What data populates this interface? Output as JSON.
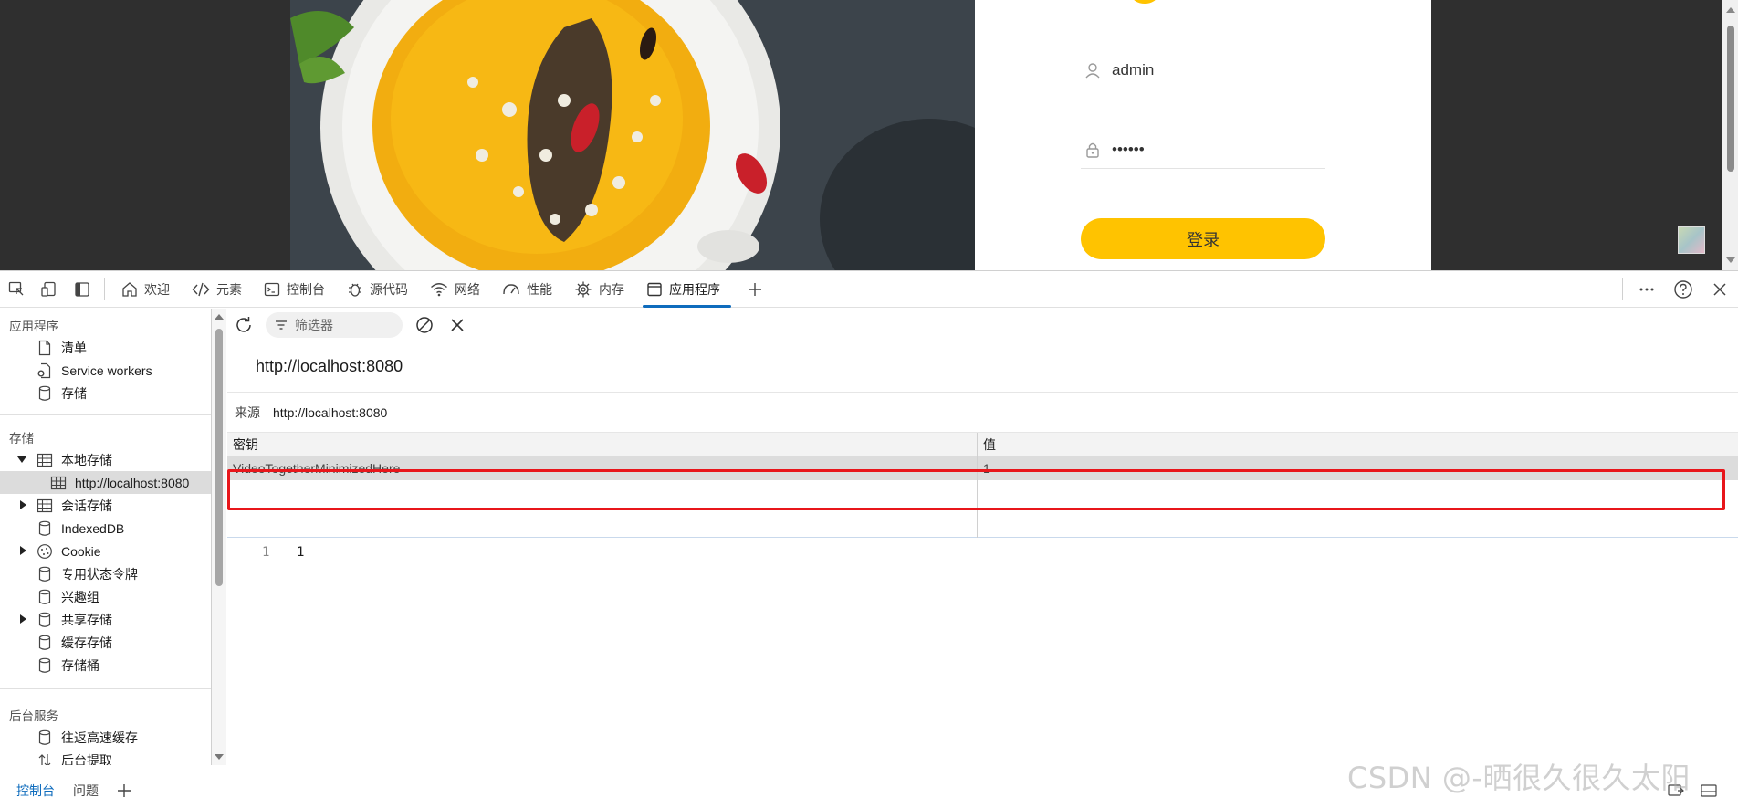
{
  "page": {
    "username_value": "admin",
    "password_value": "••••••",
    "login_button": "登录"
  },
  "toolbar": {
    "tabs": [
      {
        "label": "欢迎",
        "icon": "home-icon"
      },
      {
        "label": "元素",
        "icon": "code-icon"
      },
      {
        "label": "控制台",
        "icon": "console-icon"
      },
      {
        "label": "源代码",
        "icon": "bug-icon"
      },
      {
        "label": "网络",
        "icon": "wifi-icon"
      },
      {
        "label": "性能",
        "icon": "gauge-icon"
      },
      {
        "label": "内存",
        "icon": "chip-icon"
      },
      {
        "label": "应用程序",
        "icon": "window-icon",
        "active": true
      }
    ]
  },
  "sidebar": {
    "section_app": "应用程序",
    "manifest": "清单",
    "service_workers": "Service workers",
    "storage": "存储",
    "section_storage": "存储",
    "local_storage": "本地存储",
    "local_storage_origin": "http://localhost:8080",
    "session_storage": "会话存储",
    "indexeddb": "IndexedDB",
    "cookie": "Cookie",
    "private_state_tokens": "专用状态令牌",
    "interest_groups": "兴趣组",
    "shared_storage": "共享存储",
    "cache_storage": "缓存存储",
    "storage_buckets": "存储桶",
    "section_background": "后台服务",
    "bfcache": "往返高速缓存",
    "background_fetch": "后台提取"
  },
  "panel": {
    "filter_placeholder": "筛选器",
    "origin_title": "http://localhost:8080",
    "origin_key": "来源",
    "origin_value": "http://localhost:8080",
    "col_key": "密钥",
    "col_value": "值",
    "rows": [
      {
        "key": "VideoTogetherMinimizedHere",
        "value": "1"
      }
    ],
    "viewer_line": "1",
    "viewer_value": "1"
  },
  "drawer": {
    "console_tab": "控制台",
    "issues_tab": "问题"
  },
  "watermark": "CSDN @-晒很久很久太阳",
  "colors": {
    "accent": "#0f6cbd",
    "login_button": "#ffc300",
    "highlight": "#e8161b"
  }
}
